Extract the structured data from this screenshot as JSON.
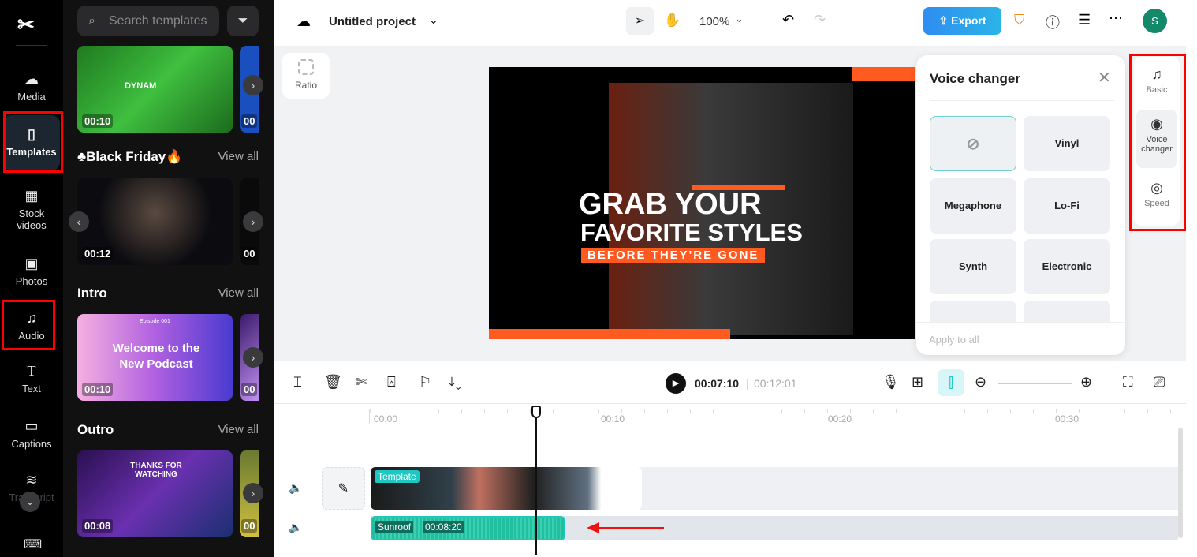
{
  "rail": {
    "items": [
      {
        "label": "Media",
        "icon": "cloud-upload-icon"
      },
      {
        "label": "Templates",
        "icon": "templates-icon",
        "active": true
      },
      {
        "label": "Stock videos",
        "icon": "film-icon"
      },
      {
        "label": "Photos",
        "icon": "image-icon"
      },
      {
        "label": "Audio",
        "icon": "music-note-icon"
      },
      {
        "label": "Text",
        "icon": "text-icon"
      },
      {
        "label": "Captions",
        "icon": "captions-icon"
      },
      {
        "label": "Transcript",
        "icon": "transcript-icon"
      }
    ]
  },
  "panel": {
    "search_placeholder": "Search templates",
    "sections": [
      {
        "title": "",
        "thumbs": [
          {
            "duration": "00:10",
            "text": "DYNAM"
          }
        ],
        "next_dur": "00"
      },
      {
        "title": "♣Black Friday🔥",
        "view_all": "View all",
        "thumbs": [
          {
            "duration": "00:12"
          }
        ],
        "next_dur": "00"
      },
      {
        "title": "Intro",
        "view_all": "View all",
        "thumbs": [
          {
            "duration": "00:10",
            "text": "Welcome to the New Podcast",
            "small": "Episode 001"
          }
        ],
        "next_dur": "00"
      },
      {
        "title": "Outro",
        "view_all": "View all",
        "thumbs": [
          {
            "duration": "00:08",
            "text": "THANKS FOR WATCHING"
          }
        ],
        "next_dur": "00"
      }
    ]
  },
  "topbar": {
    "project": "Untitled project",
    "zoom": "100%",
    "export": "Export",
    "avatar": "S"
  },
  "canvas": {
    "ratio": "Ratio",
    "headline1": "GRAB YOUR",
    "headline2": "FAVORITE STYLES",
    "tag": "BEFORE THEY'RE GONE"
  },
  "voice_changer": {
    "title": "Voice changer",
    "options": [
      "None",
      "Vinyl",
      "Megaphone",
      "Lo-Fi",
      "Synth",
      "Electronic"
    ],
    "selected": "None",
    "apply_all": "Apply to all"
  },
  "side": {
    "items": [
      {
        "label": "Basic",
        "icon": "music-note-icon"
      },
      {
        "label": "Voice changer",
        "icon": "voice-changer-icon",
        "active": true
      },
      {
        "label": "Speed",
        "icon": "speed-icon"
      }
    ]
  },
  "timeline": {
    "current": "00:07:10",
    "total": "00:12:01",
    "ruler": [
      "00:00",
      "00:10",
      "00:20",
      "00:30"
    ],
    "video_clip": "Template",
    "audio_clip": {
      "name": "Sunroof",
      "duration": "00:08:20"
    }
  },
  "colors": {
    "accent": "#1fc7c1",
    "export": "#2f8df0",
    "highlight": "#ff0000",
    "brand_orange": "#ff5a1f"
  }
}
